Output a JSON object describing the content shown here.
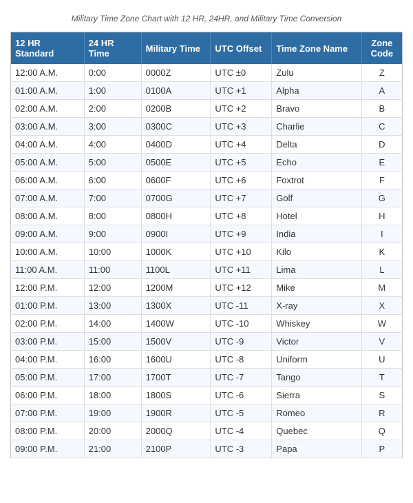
{
  "subtitle": "Military Time Zone Chart with 12 HR, 24HR, and Military Time Conversion",
  "header": {
    "col1": "12 HR Standard",
    "col2": "24 HR Time",
    "col3": "Military Time",
    "col4": "UTC Offset",
    "col5": "Time Zone Name",
    "col6": "Zone Code"
  },
  "rows": [
    {
      "hr12": "12:00 A.M.",
      "hr24": "0:00",
      "mil": "0000Z",
      "utc": "UTC ±0",
      "name": "Zulu",
      "code": "Z"
    },
    {
      "hr12": "01:00 A.M.",
      "hr24": "1:00",
      "mil": "0100A",
      "utc": "UTC +1",
      "name": "Alpha",
      "code": "A"
    },
    {
      "hr12": "02:00 A.M.",
      "hr24": "2:00",
      "mil": "0200B",
      "utc": "UTC +2",
      "name": "Bravo",
      "code": "B"
    },
    {
      "hr12": "03:00 A.M.",
      "hr24": "3:00",
      "mil": "0300C",
      "utc": "UTC +3",
      "name": "Charlie",
      "code": "C"
    },
    {
      "hr12": "04:00 A.M.",
      "hr24": "4:00",
      "mil": "0400D",
      "utc": "UTC +4",
      "name": "Delta",
      "code": "D"
    },
    {
      "hr12": "05:00 A.M.",
      "hr24": "5:00",
      "mil": "0500E",
      "utc": "UTC +5",
      "name": "Echo",
      "code": "E"
    },
    {
      "hr12": "06:00 A.M.",
      "hr24": "6:00",
      "mil": "0600F",
      "utc": "UTC +6",
      "name": "Foxtrot",
      "code": "F"
    },
    {
      "hr12": "07:00 A.M.",
      "hr24": "7:00",
      "mil": "0700G",
      "utc": "UTC +7",
      "name": "Golf",
      "code": "G"
    },
    {
      "hr12": "08:00 A.M.",
      "hr24": "8:00",
      "mil": "0800H",
      "utc": "UTC +8",
      "name": "Hotel",
      "code": "H"
    },
    {
      "hr12": "09:00 A.M.",
      "hr24": "9:00",
      "mil": "0900I",
      "utc": "UTC +9",
      "name": "India",
      "code": "I"
    },
    {
      "hr12": "10:00 A.M.",
      "hr24": "10:00",
      "mil": "1000K",
      "utc": "UTC +10",
      "name": "Kilo",
      "code": "K"
    },
    {
      "hr12": "11:00 A.M.",
      "hr24": "11:00",
      "mil": "1100L",
      "utc": "UTC +11",
      "name": "Lima",
      "code": "L"
    },
    {
      "hr12": "12:00 P.M.",
      "hr24": "12:00",
      "mil": "1200M",
      "utc": "UTC +12",
      "name": "Mike",
      "code": "M"
    },
    {
      "hr12": "01:00 P.M.",
      "hr24": "13:00",
      "mil": "1300X",
      "utc": "UTC -11",
      "name": "X-ray",
      "code": "X"
    },
    {
      "hr12": "02:00 P.M.",
      "hr24": "14:00",
      "mil": "1400W",
      "utc": "UTC -10",
      "name": "Whiskey",
      "code": "W"
    },
    {
      "hr12": "03:00 P.M.",
      "hr24": "15:00",
      "mil": "1500V",
      "utc": "UTC -9",
      "name": "Victor",
      "code": "V"
    },
    {
      "hr12": "04:00 P.M.",
      "hr24": "16:00",
      "mil": "1600U",
      "utc": "UTC -8",
      "name": "Uniform",
      "code": "U"
    },
    {
      "hr12": "05:00 P.M.",
      "hr24": "17:00",
      "mil": "1700T",
      "utc": "UTC -7",
      "name": "Tango",
      "code": "T"
    },
    {
      "hr12": "06:00 P.M.",
      "hr24": "18:00",
      "mil": "1800S",
      "utc": "UTC -6",
      "name": "Sierra",
      "code": "S"
    },
    {
      "hr12": "07:00 P.M.",
      "hr24": "19:00",
      "mil": "1900R",
      "utc": "UTC -5",
      "name": "Romeo",
      "code": "R"
    },
    {
      "hr12": "08:00 P.M.",
      "hr24": "20:00",
      "mil": "2000Q",
      "utc": "UTC -4",
      "name": "Quebec",
      "code": "Q"
    },
    {
      "hr12": "09:00 P.M.",
      "hr24": "21:00",
      "mil": "2100P",
      "utc": "UTC -3",
      "name": "Papa",
      "code": "P"
    }
  ]
}
